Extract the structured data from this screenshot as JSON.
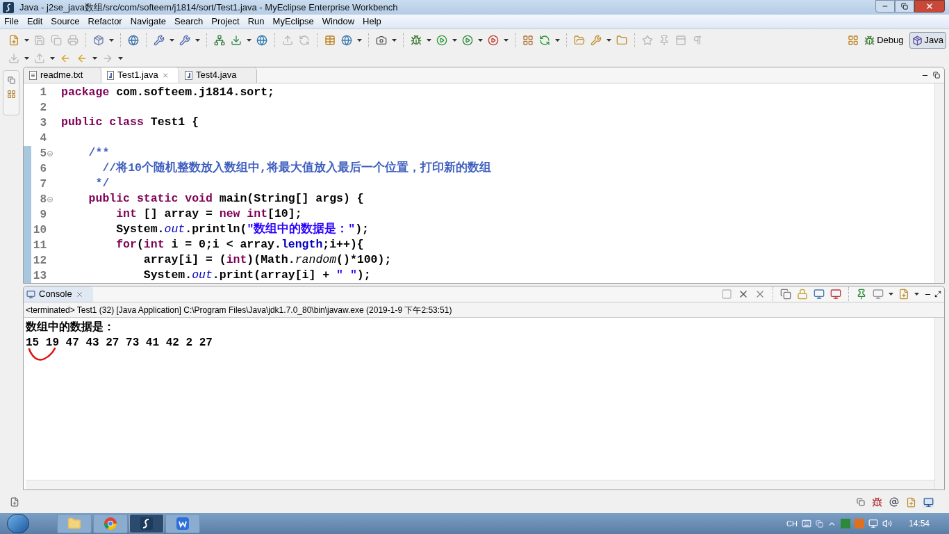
{
  "window": {
    "title": "Java - j2se_java数组/src/com/softeem/j1814/sort/Test1.java - MyEclipse Enterprise Workbench"
  },
  "menu": [
    "File",
    "Edit",
    "Source",
    "Refactor",
    "Navigate",
    "Search",
    "Project",
    "Run",
    "MyEclipse",
    "Window",
    "Help"
  ],
  "perspectives": [
    {
      "label": "Debug",
      "selected": false
    },
    {
      "label": "Java",
      "selected": true
    }
  ],
  "editor_tabs": [
    {
      "label": "readme.txt",
      "kind": "text",
      "selected": false
    },
    {
      "label": "Test1.java",
      "kind": "java",
      "selected": true
    },
    {
      "label": "Test4.java",
      "kind": "java",
      "selected": false
    }
  ],
  "code_lines": [
    {
      "number": "1",
      "fold": false,
      "changed": false,
      "tokens": [
        {
          "kind": "kw",
          "text": "package"
        },
        {
          "kind": "plain",
          "text": " com.softeem.j1814.sort;"
        }
      ]
    },
    {
      "number": "2",
      "fold": false,
      "changed": false
    },
    {
      "number": "3",
      "fold": false,
      "changed": false,
      "tokens": [
        {
          "kind": "kw",
          "text": "public class"
        },
        {
          "kind": "plain",
          "text": " Test1 {"
        }
      ]
    },
    {
      "number": "4",
      "fold": false,
      "changed": false
    },
    {
      "number": "5",
      "fold": true,
      "changed": true,
      "tokens": [
        {
          "kind": "doc",
          "text": "    /**"
        }
      ]
    },
    {
      "number": "6",
      "fold": false,
      "changed": true,
      "tokens": [
        {
          "kind": "doc",
          "text": "      //将10个随机整数放入数组中,将最大值放入最后一个位置，打印新的数组"
        }
      ]
    },
    {
      "number": "7",
      "fold": false,
      "changed": true,
      "tokens": [
        {
          "kind": "doc",
          "text": "     */"
        }
      ]
    },
    {
      "number": "8",
      "fold": true,
      "changed": true,
      "tokens": [
        {
          "kind": "kw",
          "text": "    public static void"
        },
        {
          "kind": "plain",
          "text": " main(String[] args) {"
        }
      ]
    },
    {
      "number": "9",
      "fold": false,
      "changed": true,
      "tokens": [
        {
          "kind": "kw",
          "text": "        int"
        },
        {
          "kind": "plain",
          "text": " [] array = "
        },
        {
          "kind": "kw",
          "text": "new int"
        },
        {
          "kind": "plain",
          "text": "[10];"
        }
      ]
    },
    {
      "number": "10",
      "fold": false,
      "changed": true,
      "tokens": [
        {
          "kind": "plain",
          "text": "        System."
        },
        {
          "kind": "static",
          "text": "out"
        },
        {
          "kind": "plain",
          "text": ".println("
        },
        {
          "kind": "string",
          "text": "\"数组中的数据是：\""
        },
        {
          "kind": "plain",
          "text": ");"
        }
      ]
    },
    {
      "number": "11",
      "fold": false,
      "changed": true,
      "tokens": [
        {
          "kind": "kw",
          "text": "        for"
        },
        {
          "kind": "plain",
          "text": "("
        },
        {
          "kind": "kw",
          "text": "int"
        },
        {
          "kind": "plain",
          "text": " i = 0;i < array."
        },
        {
          "kind": "field",
          "text": "length"
        },
        {
          "kind": "plain",
          "text": ";i++){"
        }
      ]
    },
    {
      "number": "12",
      "fold": false,
      "changed": true,
      "tokens": [
        {
          "kind": "plain",
          "text": "            array[i] = ("
        },
        {
          "kind": "kw",
          "text": "int"
        },
        {
          "kind": "plain",
          "text": ")(Math."
        },
        {
          "kind": "method",
          "text": "random"
        },
        {
          "kind": "plain",
          "text": "()*100);"
        }
      ]
    },
    {
      "number": "13",
      "fold": false,
      "changed": true,
      "tokens": [
        {
          "kind": "plain",
          "text": "            System."
        },
        {
          "kind": "static",
          "text": "out"
        },
        {
          "kind": "plain",
          "text": ".print(array[i] + "
        },
        {
          "kind": "string",
          "text": "\" \""
        },
        {
          "kind": "plain",
          "text": ");"
        }
      ]
    }
  ],
  "console": {
    "tab": "Console",
    "status": "<terminated> Test1 (32) [Java Application] C:\\Program Files\\Java\\jdk1.7.0_80\\bin\\javaw.exe (2019-1-9 下午2:53:51)",
    "output": [
      "数组中的数据是：",
      "15 19 47 43 27 73 41 42 2 27"
    ]
  },
  "taskbar": {
    "apps": [
      {
        "kind": "folder",
        "selected": false
      },
      {
        "kind": "chrome",
        "selected": false
      },
      {
        "kind": "eclipse",
        "selected": true
      },
      {
        "kind": "wps",
        "selected": false
      }
    ],
    "language": "CH",
    "clock": "14:54"
  }
}
